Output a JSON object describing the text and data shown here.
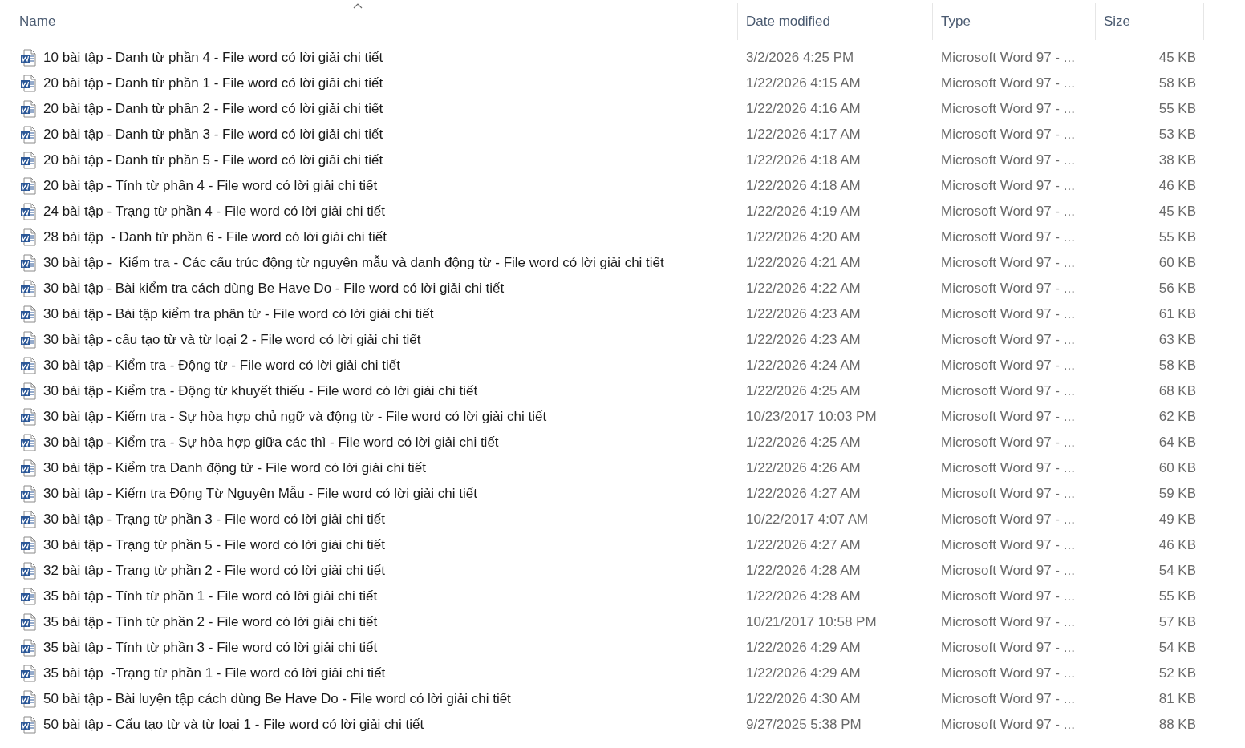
{
  "columns": [
    {
      "label": "Name",
      "sorted": true
    },
    {
      "label": "Date modified",
      "sorted": false
    },
    {
      "label": "Type",
      "sorted": false
    },
    {
      "label": "Size",
      "sorted": false
    }
  ],
  "files": [
    {
      "name": "10 bài tập - Danh từ phần 4 - File word có lời giải chi tiết",
      "date": "3/2/2026 4:25 PM",
      "type": "Microsoft Word 97 - ...",
      "size": "45 KB"
    },
    {
      "name": "20 bài tập - Danh từ phần 1 - File word có lời giải chi tiết",
      "date": "1/22/2026 4:15 AM",
      "type": "Microsoft Word 97 - ...",
      "size": "58 KB"
    },
    {
      "name": "20 bài tập - Danh từ phần 2 - File word có lời giải chi tiết",
      "date": "1/22/2026 4:16 AM",
      "type": "Microsoft Word 97 - ...",
      "size": "55 KB"
    },
    {
      "name": "20 bài tập - Danh từ phần 3 - File word có lời giải chi tiết",
      "date": "1/22/2026 4:17 AM",
      "type": "Microsoft Word 97 - ...",
      "size": "53 KB"
    },
    {
      "name": "20 bài tập - Danh từ phần 5 - File word có lời giải chi tiết",
      "date": "1/22/2026 4:18 AM",
      "type": "Microsoft Word 97 - ...",
      "size": "38 KB"
    },
    {
      "name": "20 bài tập - Tính từ phần 4 - File word có lời giải chi tiết",
      "date": "1/22/2026 4:18 AM",
      "type": "Microsoft Word 97 - ...",
      "size": "46 KB"
    },
    {
      "name": "24 bài tập - Trạng từ phần 4 - File word có lời giải chi tiết",
      "date": "1/22/2026 4:19 AM",
      "type": "Microsoft Word 97 - ...",
      "size": "45 KB"
    },
    {
      "name": "28 bài tập  - Danh từ phần 6 - File word có lời giải chi tiết",
      "date": "1/22/2026 4:20 AM",
      "type": "Microsoft Word 97 - ...",
      "size": "55 KB"
    },
    {
      "name": "30 bài tập -  Kiểm tra - Các cấu trúc động từ nguyên mẫu và danh động từ - File word có lời giải chi tiết",
      "date": "1/22/2026 4:21 AM",
      "type": "Microsoft Word 97 - ...",
      "size": "60 KB"
    },
    {
      "name": "30 bài tập - Bài kiểm tra cách dùng Be Have Do - File word có lời giải chi tiết",
      "date": "1/22/2026 4:22 AM",
      "type": "Microsoft Word 97 - ...",
      "size": "56 KB"
    },
    {
      "name": "30 bài tập - Bài tập kiểm tra phân từ - File word có lời giải chi tiết",
      "date": "1/22/2026 4:23 AM",
      "type": "Microsoft Word 97 - ...",
      "size": "61 KB"
    },
    {
      "name": "30 bài tập - cấu tạo từ và từ loại 2 - File word có lời giải chi tiết",
      "date": "1/22/2026 4:23 AM",
      "type": "Microsoft Word 97 - ...",
      "size": "63 KB"
    },
    {
      "name": "30 bài tập - Kiểm tra - Động từ - File word có lời giải chi tiết",
      "date": "1/22/2026 4:24 AM",
      "type": "Microsoft Word 97 - ...",
      "size": "58 KB"
    },
    {
      "name": "30 bài tập - Kiểm tra - Động từ khuyết thiếu - File word có lời giải chi tiết",
      "date": "1/22/2026 4:25 AM",
      "type": "Microsoft Word 97 - ...",
      "size": "68 KB"
    },
    {
      "name": "30 bài tập - Kiểm tra - Sự hòa hợp chủ ngữ và động từ - File word có lời giải chi tiết",
      "date": "10/23/2017 10:03 PM",
      "type": "Microsoft Word 97 - ...",
      "size": "62 KB"
    },
    {
      "name": "30 bài tập - Kiểm tra - Sự hòa hợp giữa các thì - File word có lời giải chi tiết",
      "date": "1/22/2026 4:25 AM",
      "type": "Microsoft Word 97 - ...",
      "size": "64 KB"
    },
    {
      "name": "30 bài tập - Kiểm tra Danh động từ - File word có lời giải chi tiết",
      "date": "1/22/2026 4:26 AM",
      "type": "Microsoft Word 97 - ...",
      "size": "60 KB"
    },
    {
      "name": "30 bài tập - Kiểm tra Động Từ Nguyên Mẫu - File word có lời giải chi tiết",
      "date": "1/22/2026 4:27 AM",
      "type": "Microsoft Word 97 - ...",
      "size": "59 KB"
    },
    {
      "name": "30 bài tập - Trạng từ phần 3 - File word có lời giải chi tiết",
      "date": "10/22/2017 4:07 AM",
      "type": "Microsoft Word 97 - ...",
      "size": "49 KB"
    },
    {
      "name": "30 bài tập - Trạng từ phần 5 - File word có lời giải chi tiết",
      "date": "1/22/2026 4:27 AM",
      "type": "Microsoft Word 97 - ...",
      "size": "46 KB"
    },
    {
      "name": "32 bài tập - Trạng từ phần 2 - File word có lời giải chi tiết",
      "date": "1/22/2026 4:28 AM",
      "type": "Microsoft Word 97 - ...",
      "size": "54 KB"
    },
    {
      "name": "35 bài tập - Tính từ phần 1 - File word có lời giải chi tiết",
      "date": "1/22/2026 4:28 AM",
      "type": "Microsoft Word 97 - ...",
      "size": "55 KB"
    },
    {
      "name": "35 bài tập - Tính từ phần 2 - File word có lời giải chi tiết",
      "date": "10/21/2017 10:58 PM",
      "type": "Microsoft Word 97 - ...",
      "size": "57 KB"
    },
    {
      "name": "35 bài tập - Tính từ phần 3 - File word có lời giải chi tiết",
      "date": "1/22/2026 4:29 AM",
      "type": "Microsoft Word 97 - ...",
      "size": "54 KB"
    },
    {
      "name": "35 bài tập  -Trạng từ phần 1 - File word có lời giải chi tiết",
      "date": "1/22/2026 4:29 AM",
      "type": "Microsoft Word 97 - ...",
      "size": "52 KB"
    },
    {
      "name": "50 bài tập - Bài luyện tập cách dùng Be Have Do - File word có lời giải chi tiết",
      "date": "1/22/2026 4:30 AM",
      "type": "Microsoft Word 97 - ...",
      "size": "81 KB"
    },
    {
      "name": "50 bài tập - Cấu tạo từ và từ loại 1 - File word có lời giải chi tiết",
      "date": "9/27/2025 5:38 PM",
      "type": "Microsoft Word 97 - ...",
      "size": "88 KB"
    }
  ]
}
